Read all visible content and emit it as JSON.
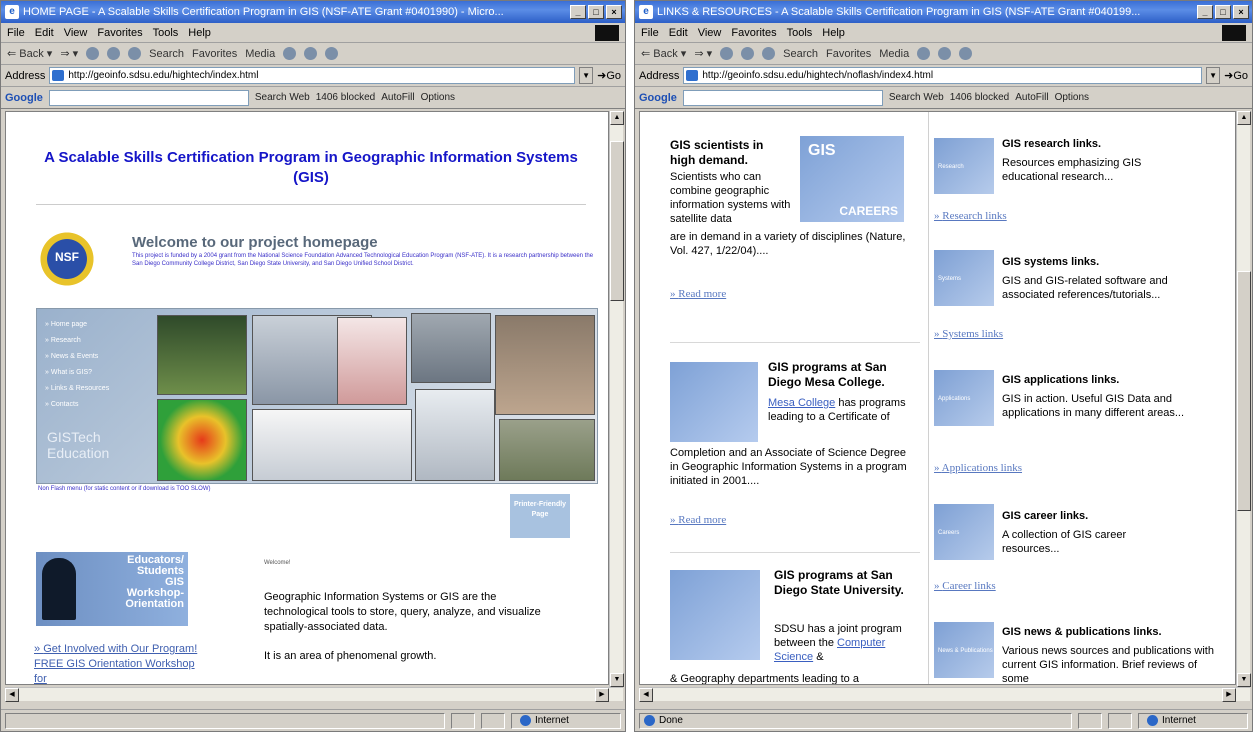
{
  "left": {
    "title": "HOME PAGE - A Scalable Skills Certification Program in GIS (NSF-ATE Grant #0401990) - Micro...",
    "menu": [
      "File",
      "Edit",
      "View",
      "Favorites",
      "Tools",
      "Help"
    ],
    "toolbar": [
      "Back",
      "Search",
      "Favorites",
      "Media"
    ],
    "address_label": "Address",
    "address_url": "http://geoinfo.sdsu.edu/hightech/index.html",
    "go_label": "Go",
    "google": {
      "logo": "Google",
      "search_web": "Search Web",
      "blocked": "1406 blocked",
      "autofill": "AutoFill",
      "options": "Options"
    },
    "page": {
      "heading": "A Scalable Skills Certification Program in Geographic Information Systems (GIS)",
      "nsf_label": "NSF",
      "welcome_heading": "Welcome to our project homepage",
      "welcome_text": "This project is funded by a 2004 grant from the National Science Foundation Advanced Technological Education Program (NSF-ATE). It is a research partnership between the San Diego Community College District, San Diego State University, and San Diego Unified School District.",
      "nav": [
        "Home page",
        "Research",
        "News & Events",
        "What is GIS?",
        "Links & Resources",
        "Contacts"
      ],
      "brand": [
        "GISTech",
        "Education"
      ],
      "flash_note": "Non Flash menu (for static content or if download is TOO SLOW)",
      "print_btn": "Printer-Friendly Page",
      "edu_banner": [
        "Educators/",
        "Students",
        "GIS",
        "Workshop-",
        "Orientation"
      ],
      "get_involved": "Get Involved with Our Program! FREE GIS Orientation Workshop for",
      "welcome_small": "Welcome!",
      "body_p1": "Geographic Information Systems or GIS are the technological tools to store, query, analyze, and visualize spatially-associated data.",
      "body_p2": "It is an area of phenomenal growth."
    },
    "status_zone": "Internet"
  },
  "right": {
    "title": "LINKS & RESOURCES - A Scalable Skills Certification Program in GIS (NSF-ATE Grant #040199...",
    "menu": [
      "File",
      "Edit",
      "View",
      "Favorites",
      "Tools",
      "Help"
    ],
    "address_label": "Address",
    "address_url": "http://geoinfo.sdsu.edu/hightech/noflash/index4.html",
    "go_label": "Go",
    "google": {
      "logo": "Google",
      "search_web": "Search Web",
      "blocked": "1406 blocked",
      "autofill": "AutoFill",
      "options": "Options"
    },
    "articles": [
      {
        "title": "GIS scientists in high demand.",
        "body": "Scientists who can combine geographic information systems with satellite data are in demand in a variety of disciplines (Nature, Vol. 427, 1/22/04)....",
        "more": "Read more",
        "img": [
          "GIS",
          "CAREERS"
        ]
      },
      {
        "title": "GIS programs at San Diego Mesa College.",
        "link": "Mesa College",
        "body": "has programs leading to a Certificate of Completion and an Associate of Science Degree in Geographic Information Systems in a program initiated in 2001....",
        "more": "Read more"
      },
      {
        "title": "GIS programs at San Diego State University.",
        "body_a": "SDSU has a joint program between the",
        "link": "Computer Science",
        "body_b": "& Geography departments leading to a"
      }
    ],
    "resources": [
      {
        "title": "GIS research links.",
        "desc": "Resources emphasizing GIS educational research...",
        "link": "Research links",
        "icon": "Research"
      },
      {
        "title": "GIS systems links.",
        "desc": "GIS and GIS-related software and associated references/tutorials...",
        "link": "Systems links",
        "icon": "Systems"
      },
      {
        "title": "GIS applications links.",
        "desc": "GIS in action. Useful GIS Data and applications in many different areas...",
        "link": "Applications links",
        "icon": "Applications"
      },
      {
        "title": "GIS career links.",
        "desc": "A collection of GIS career resources...",
        "link": "Career links",
        "icon": "Careers"
      },
      {
        "title": "GIS news & publications links.",
        "desc": "Various news sources and publications with current GIS information. Brief reviews of some",
        "icon": "News & Publications"
      }
    ],
    "status_text": "Done",
    "status_zone": "Internet"
  }
}
